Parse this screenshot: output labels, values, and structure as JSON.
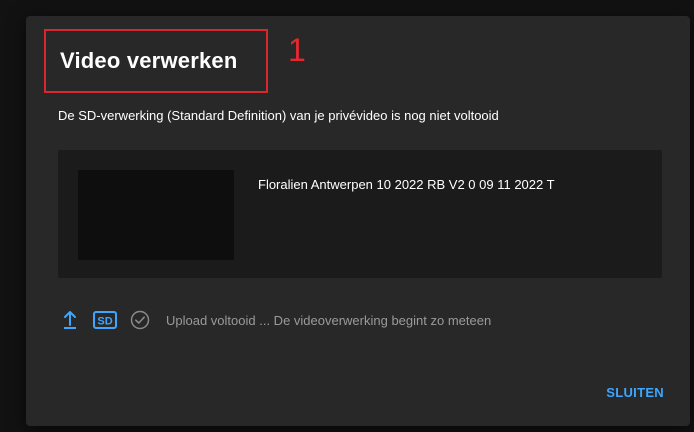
{
  "dialog": {
    "title": "Video verwerken",
    "annotation_number": "1",
    "message": "De SD-verwerking (Standard Definition) van je privévideo is nog niet voltooid",
    "video_name": "Floralien Antwerpen 10 2022 RB V2 0 09 11 2022 T",
    "status_text": "Upload voltooid ... De videoverwerking begint zo meteen",
    "sd_badge": "SD",
    "close_label": "SLUITEN"
  },
  "colors": {
    "dialog_background": "#282828",
    "accent_blue": "#3ea6ff",
    "annotation_red": "#d8282e"
  },
  "icons": {
    "upload": "upload-icon",
    "sd": "sd-quality-icon",
    "check": "check-circle-icon"
  }
}
